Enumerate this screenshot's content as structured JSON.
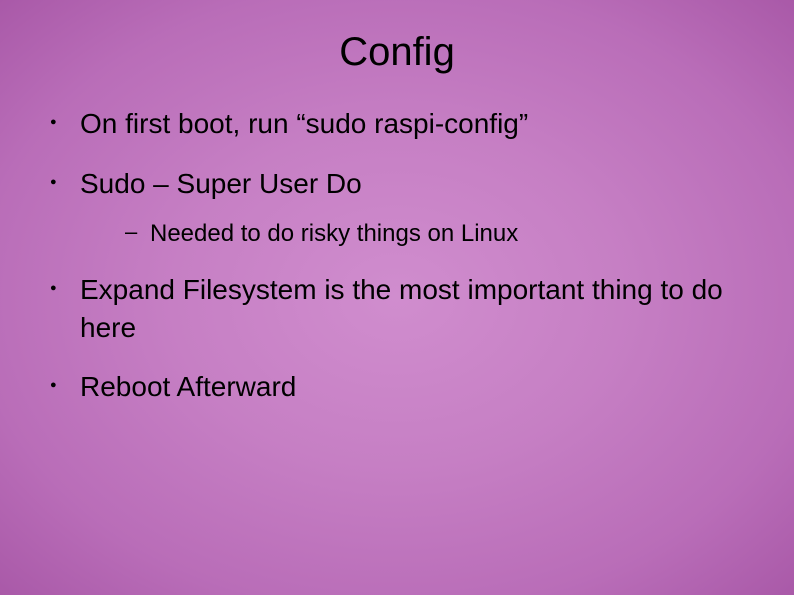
{
  "slide": {
    "title": "Config",
    "bullets": [
      {
        "text": "On first boot, run “sudo raspi-config”"
      },
      {
        "text": "Sudo – Super User Do",
        "sub": [
          "Needed to do risky things on Linux"
        ]
      },
      {
        "text": "Expand Filesystem is the most important thing to do here"
      },
      {
        "text": "Reboot Afterward"
      }
    ]
  }
}
